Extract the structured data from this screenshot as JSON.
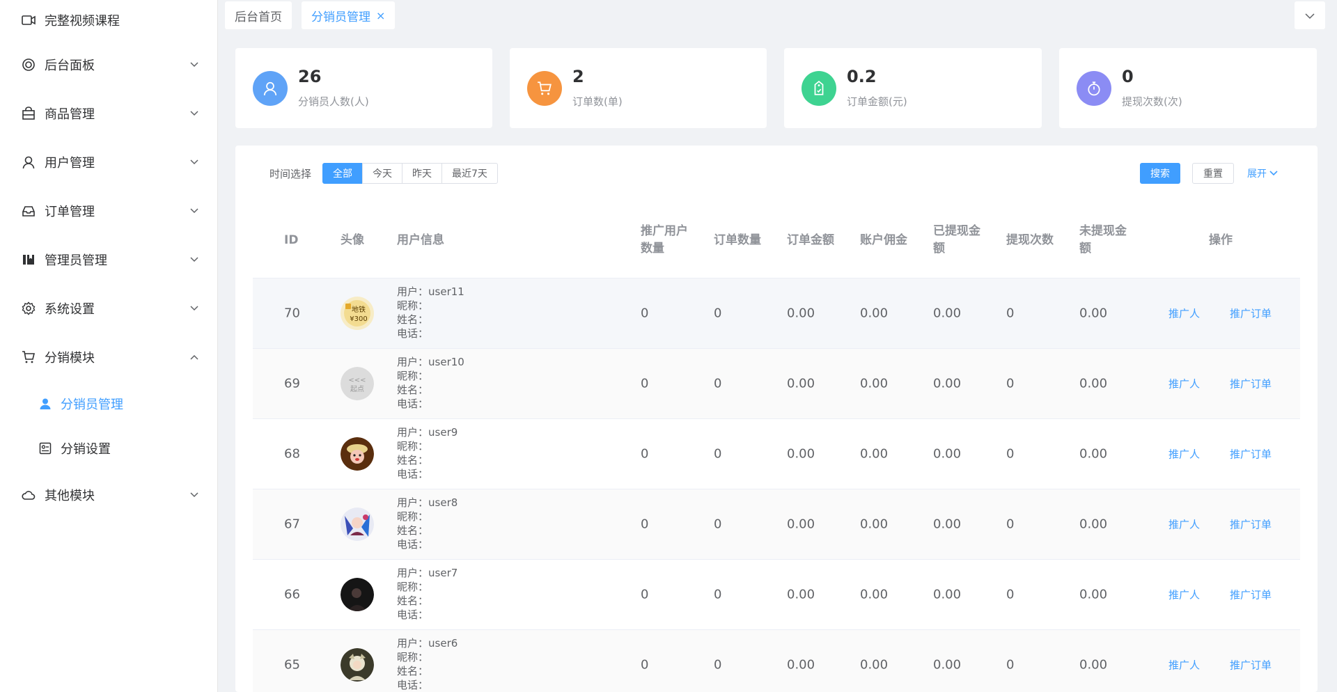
{
  "sidebar": {
    "items": [
      {
        "label": "完整视频课程",
        "icon": "video-icon",
        "expandable": false
      },
      {
        "label": "后台面板",
        "icon": "dashboard-icon",
        "expandable": true
      },
      {
        "label": "商品管理",
        "icon": "shopping-bag-icon",
        "expandable": true
      },
      {
        "label": "用户管理",
        "icon": "user-icon",
        "expandable": true
      },
      {
        "label": "订单管理",
        "icon": "inbox-icon",
        "expandable": true
      },
      {
        "label": "管理员管理",
        "icon": "notebook-icon",
        "expandable": true
      },
      {
        "label": "系统设置",
        "icon": "gear-icon",
        "expandable": true
      },
      {
        "label": "分销模块",
        "icon": "cart-icon",
        "expandable": true,
        "expanded": true
      },
      {
        "label": "其他模块",
        "icon": "cloud-icon",
        "expandable": true
      }
    ],
    "submenu": [
      {
        "label": "分销员管理",
        "icon": "user-filled-icon",
        "active": true
      },
      {
        "label": "分销设置",
        "icon": "settings-panel-icon",
        "active": false
      }
    ]
  },
  "tabs": [
    {
      "label": "后台首页",
      "active": false
    },
    {
      "label": "分销员管理",
      "active": true,
      "close": "×"
    }
  ],
  "stats": [
    {
      "value": "26",
      "label": "分销员人数(人)",
      "color": "#5fa3f7",
      "icon": "user-icon"
    },
    {
      "value": "2",
      "label": "订单数(单)",
      "color": "#f6943f",
      "icon": "cart-icon"
    },
    {
      "value": "0.2",
      "label": "订单金额(元)",
      "color": "#3ed391",
      "icon": "price-tag-icon"
    },
    {
      "value": "0",
      "label": "提现次数(次)",
      "color": "#8b8cf4",
      "icon": "stopwatch-icon"
    }
  ],
  "filter": {
    "label": "时间选择",
    "options": [
      "全部",
      "今天",
      "昨天",
      "最近7天"
    ],
    "selected": "全部",
    "search": "搜索",
    "reset": "重置",
    "expand": "展开"
  },
  "table": {
    "headers": {
      "id": "ID",
      "avatar": "头像",
      "info": "用户信息",
      "promo_users": "推广用户数量",
      "order_count": "订单数量",
      "order_amount": "订单金额",
      "commission": "账户佣金",
      "withdrawn": "已提现金额",
      "withdraw_times": "提现次数",
      "not_withdrawn": "未提现金额",
      "ops": "操作"
    },
    "info_labels": {
      "user": "用户：",
      "nickname": "昵称：",
      "name": "姓名：",
      "phone": "电话："
    },
    "op_labels": {
      "promoter": "推广人",
      "orders": "推广订单"
    },
    "rows": [
      {
        "id": "70",
        "user": "user11",
        "promo_users": "0",
        "order_count": "0",
        "order_amount": "0.00",
        "commission": "0.00",
        "withdrawn": "0.00",
        "withdraw_times": "0",
        "not_withdrawn": "0.00",
        "avatar": "coupon-avatar",
        "avatar_text": "地铁",
        "avatar_text2": "¥300"
      },
      {
        "id": "69",
        "user": "user10",
        "promo_users": "0",
        "order_count": "0",
        "order_amount": "0.00",
        "commission": "0.00",
        "withdrawn": "0.00",
        "withdraw_times": "0",
        "not_withdrawn": "0.00",
        "avatar": "logo-avatar",
        "avatar_text": "<<<",
        "avatar_text2": "起点"
      },
      {
        "id": "68",
        "user": "user9",
        "promo_users": "0",
        "order_count": "0",
        "order_amount": "0.00",
        "commission": "0.00",
        "withdrawn": "0.00",
        "withdraw_times": "0",
        "not_withdrawn": "0.00",
        "avatar": "cartoon-avatar"
      },
      {
        "id": "67",
        "user": "user8",
        "promo_users": "0",
        "order_count": "0",
        "order_amount": "0.00",
        "commission": "0.00",
        "withdrawn": "0.00",
        "withdraw_times": "0",
        "not_withdrawn": "0.00",
        "avatar": "anime-avatar"
      },
      {
        "id": "66",
        "user": "user7",
        "promo_users": "0",
        "order_count": "0",
        "order_amount": "0.00",
        "commission": "0.00",
        "withdrawn": "0.00",
        "withdraw_times": "0",
        "not_withdrawn": "0.00",
        "avatar": "dark-avatar"
      },
      {
        "id": "65",
        "user": "user6",
        "promo_users": "0",
        "order_count": "0",
        "order_amount": "0.00",
        "commission": "0.00",
        "withdrawn": "0.00",
        "withdraw_times": "0",
        "not_withdrawn": "0.00",
        "avatar": "illustration-avatar"
      }
    ]
  }
}
